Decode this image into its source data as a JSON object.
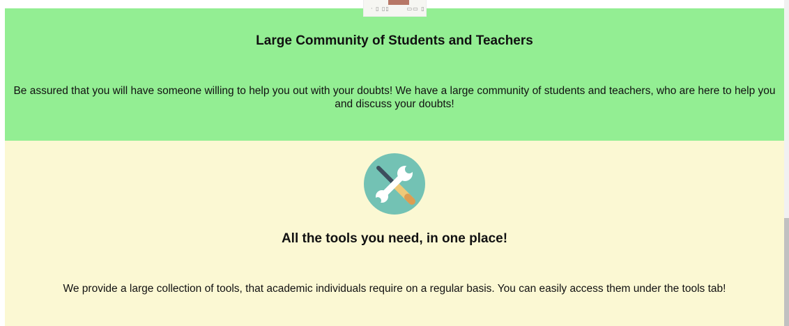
{
  "community": {
    "title": "Large Community of Students and Teachers",
    "description": "Be assured that you will have someone willing to help you out with your doubts! We have a large community of students and teachers, who are here to help you and discuss your doubts!"
  },
  "tools": {
    "title": "All the tools you need, in one place!",
    "description": "We provide a large collection of tools, that academic individuals require on a regular basis. You can easily access them under the tools tab!",
    "icon": "tools-icon"
  },
  "colors": {
    "community_bg": "#93ee93",
    "tools_bg": "#fbf8d3",
    "icon_circle": "#73c2b4"
  },
  "scroll": {
    "position_fraction": 0.67
  }
}
